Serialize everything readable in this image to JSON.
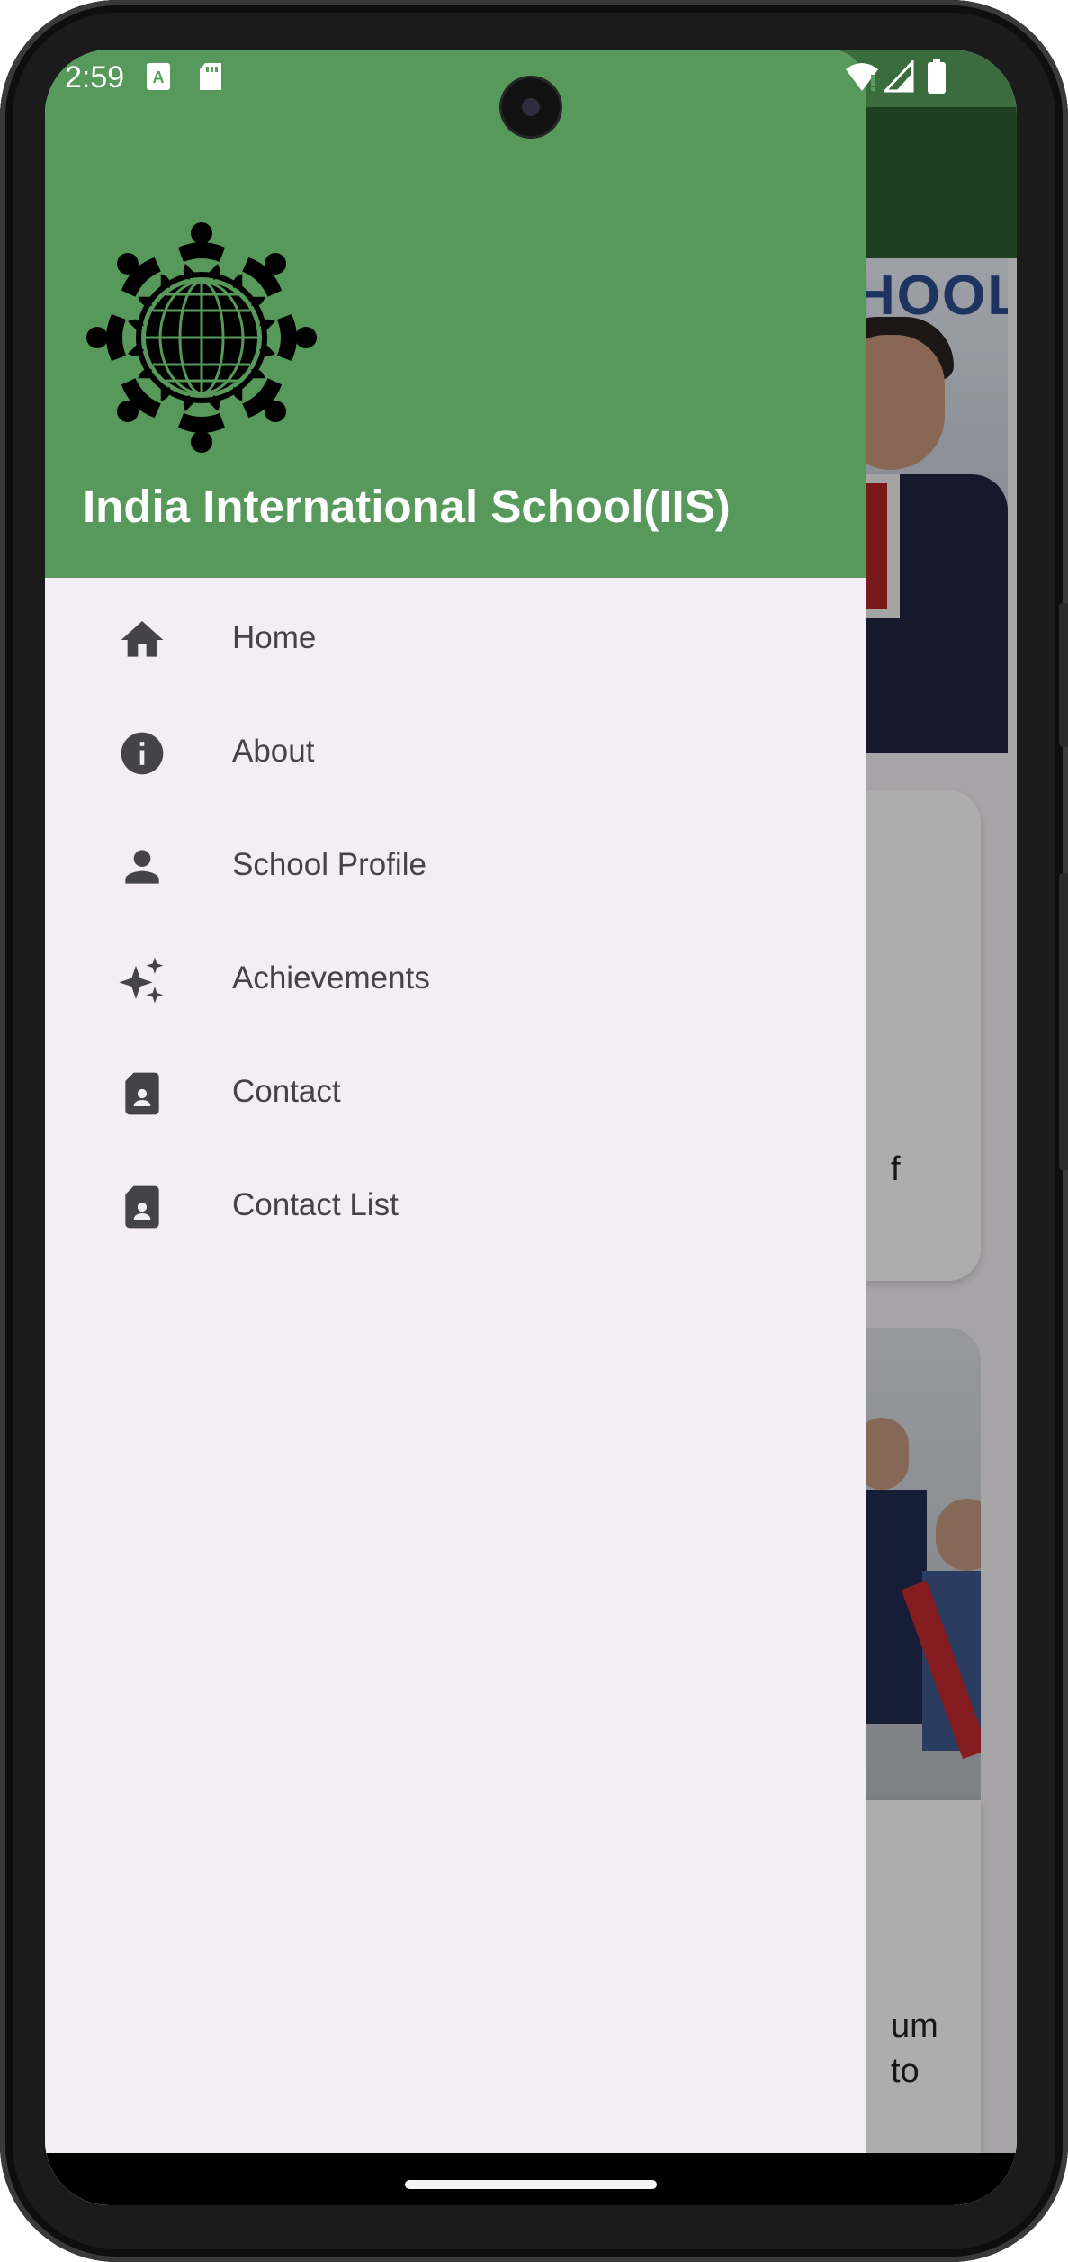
{
  "status_bar": {
    "time": "2:59",
    "icons": [
      "text-a-icon",
      "sd-card-icon",
      "wifi-alert-icon",
      "signal-icon",
      "battery-icon"
    ]
  },
  "drawer": {
    "title": "India International School(IIS)",
    "header_color": "#57995a",
    "items": [
      {
        "label": "Home",
        "icon": "home-icon"
      },
      {
        "label": "About",
        "icon": "info-icon"
      },
      {
        "label": "School Profile",
        "icon": "person-icon"
      },
      {
        "label": "Achievements",
        "icon": "sparkles-icon"
      },
      {
        "label": "Contact",
        "icon": "contact-file-icon"
      },
      {
        "label": "Contact List",
        "icon": "contact-file-icon"
      }
    ]
  },
  "background": {
    "banner_text": "HOOL",
    "card_text_1": "f",
    "card_text_2": "um",
    "card_text_3": "to"
  },
  "colors": {
    "accent": "#57995a",
    "app_bar": "#2f5d32",
    "drawer_bg": "#f3eef5",
    "menu_text": "#45434a"
  }
}
